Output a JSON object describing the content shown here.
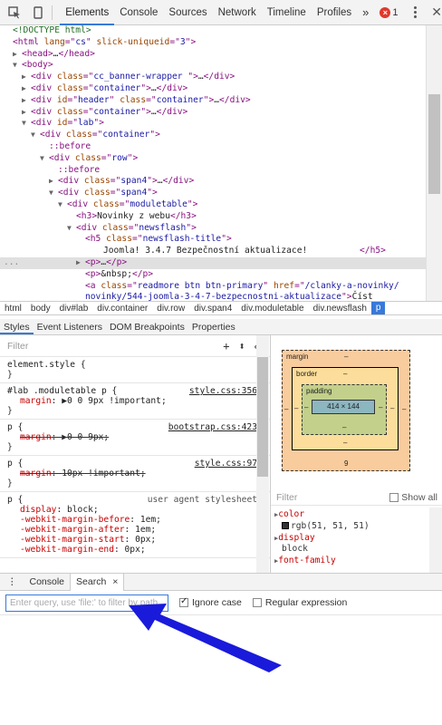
{
  "toolbar": {
    "tabs": [
      "Elements",
      "Console",
      "Sources",
      "Network",
      "Timeline",
      "Profiles"
    ],
    "more": "»",
    "error_count": "1"
  },
  "dom": {
    "lines": [
      {
        "indent": 0,
        "tri": "",
        "parts": [
          [
            "cmt",
            "<!DOCTYPE html>"
          ]
        ]
      },
      {
        "indent": 0,
        "tri": "",
        "parts": [
          [
            "tag",
            "<html "
          ],
          [
            "attr",
            "lang"
          ],
          [
            "tag",
            "=\""
          ],
          [
            "val",
            "cs"
          ],
          [
            "tag",
            "\" "
          ],
          [
            "attr",
            "slick-uniqueid"
          ],
          [
            "tag",
            "=\""
          ],
          [
            "val",
            "3"
          ],
          [
            "tag",
            "\">"
          ]
        ]
      },
      {
        "indent": 1,
        "tri": "▶",
        "parts": [
          [
            "tag",
            "<head>"
          ],
          [
            "txt",
            "…"
          ],
          [
            "tag",
            "</head>"
          ]
        ]
      },
      {
        "indent": 1,
        "tri": "▼",
        "parts": [
          [
            "tag",
            "<body>"
          ]
        ]
      },
      {
        "indent": 2,
        "tri": "▶",
        "parts": [
          [
            "tag",
            "<div "
          ],
          [
            "attr",
            "class"
          ],
          [
            "tag",
            "=\""
          ],
          [
            "val",
            "cc_banner-wrapper "
          ],
          [
            "tag",
            "\">"
          ],
          [
            "txt",
            "…"
          ],
          [
            "tag",
            "</div>"
          ]
        ]
      },
      {
        "indent": 2,
        "tri": "▶",
        "parts": [
          [
            "tag",
            "<div "
          ],
          [
            "attr",
            "class"
          ],
          [
            "tag",
            "=\""
          ],
          [
            "val",
            "container"
          ],
          [
            "tag",
            "\">"
          ],
          [
            "txt",
            "…"
          ],
          [
            "tag",
            "</div>"
          ]
        ]
      },
      {
        "indent": 2,
        "tri": "▶",
        "parts": [
          [
            "tag",
            "<div "
          ],
          [
            "attr",
            "id"
          ],
          [
            "tag",
            "=\""
          ],
          [
            "val",
            "header"
          ],
          [
            "tag",
            "\" "
          ],
          [
            "attr",
            "class"
          ],
          [
            "tag",
            "=\""
          ],
          [
            "val",
            "container"
          ],
          [
            "tag",
            "\">"
          ],
          [
            "txt",
            "…"
          ],
          [
            "tag",
            "</div>"
          ]
        ]
      },
      {
        "indent": 2,
        "tri": "▶",
        "parts": [
          [
            "tag",
            "<div "
          ],
          [
            "attr",
            "class"
          ],
          [
            "tag",
            "=\""
          ],
          [
            "val",
            "container"
          ],
          [
            "tag",
            "\">"
          ],
          [
            "txt",
            "…"
          ],
          [
            "tag",
            "</div>"
          ]
        ]
      },
      {
        "indent": 2,
        "tri": "▼",
        "parts": [
          [
            "tag",
            "<div "
          ],
          [
            "attr",
            "id"
          ],
          [
            "tag",
            "=\""
          ],
          [
            "val",
            "lab"
          ],
          [
            "tag",
            "\">"
          ]
        ]
      },
      {
        "indent": 3,
        "tri": "▼",
        "parts": [
          [
            "tag",
            "<div "
          ],
          [
            "attr",
            "class"
          ],
          [
            "tag",
            "=\""
          ],
          [
            "val",
            "container"
          ],
          [
            "tag",
            "\">"
          ]
        ]
      },
      {
        "indent": 4,
        "tri": "",
        "parts": [
          [
            "pseudo",
            "::before"
          ]
        ]
      },
      {
        "indent": 4,
        "tri": "▼",
        "parts": [
          [
            "tag",
            "<div "
          ],
          [
            "attr",
            "class"
          ],
          [
            "tag",
            "=\""
          ],
          [
            "val",
            "row"
          ],
          [
            "tag",
            "\">"
          ]
        ]
      },
      {
        "indent": 5,
        "tri": "",
        "parts": [
          [
            "pseudo",
            "::before"
          ]
        ]
      },
      {
        "indent": 5,
        "tri": "▶",
        "parts": [
          [
            "tag",
            "<div "
          ],
          [
            "attr",
            "class"
          ],
          [
            "tag",
            "=\""
          ],
          [
            "val",
            "span4"
          ],
          [
            "tag",
            "\">"
          ],
          [
            "txt",
            "…"
          ],
          [
            "tag",
            "</div>"
          ]
        ]
      },
      {
        "indent": 5,
        "tri": "▼",
        "parts": [
          [
            "tag",
            "<div "
          ],
          [
            "attr",
            "class"
          ],
          [
            "tag",
            "=\""
          ],
          [
            "val",
            "span4"
          ],
          [
            "tag",
            "\">"
          ]
        ]
      },
      {
        "indent": 6,
        "tri": "▼",
        "parts": [
          [
            "tag",
            "<div "
          ],
          [
            "attr",
            "class"
          ],
          [
            "tag",
            "=\""
          ],
          [
            "val",
            "moduletable"
          ],
          [
            "tag",
            "\">"
          ]
        ]
      },
      {
        "indent": 7,
        "tri": "",
        "parts": [
          [
            "tag",
            "<h3>"
          ],
          [
            "txt",
            "Novinky z webu"
          ],
          [
            "tag",
            "</h3>"
          ]
        ]
      },
      {
        "indent": 7,
        "tri": "▼",
        "parts": [
          [
            "tag",
            "<div "
          ],
          [
            "attr",
            "class"
          ],
          [
            "tag",
            "=\""
          ],
          [
            "val",
            "newsflash"
          ],
          [
            "tag",
            "\">"
          ]
        ]
      },
      {
        "indent": 8,
        "tri": "",
        "parts": [
          [
            "tag",
            "<h5 "
          ],
          [
            "attr",
            "class"
          ],
          [
            "tag",
            "=\""
          ],
          [
            "val",
            "newsflash-title"
          ],
          [
            "tag",
            "\">"
          ]
        ]
      },
      {
        "indent": 10,
        "tri": "",
        "parts": [
          [
            "txt",
            "Joomla! 3.4.7 Bezpečnostní aktualizace!          "
          ],
          [
            "tag",
            "</h5>"
          ]
        ]
      },
      {
        "indent": 8,
        "tri": "▶",
        "hl": true,
        "parts": [
          [
            "tag",
            "<p>"
          ],
          [
            "txt",
            "…"
          ],
          [
            "tag",
            "</p>"
          ]
        ]
      },
      {
        "indent": 8,
        "tri": "",
        "parts": [
          [
            "tag",
            "<p>"
          ],
          [
            "txt",
            "&nbsp;"
          ],
          [
            "tag",
            "</p>"
          ]
        ]
      },
      {
        "indent": 8,
        "tri": "",
        "parts": [
          [
            "tag",
            "<a "
          ],
          [
            "attr",
            "class"
          ],
          [
            "tag",
            "=\""
          ],
          [
            "val",
            "readmore btn btn-primary"
          ],
          [
            "tag",
            "\" "
          ],
          [
            "attr",
            "href"
          ],
          [
            "tag",
            "=\""
          ],
          [
            "val",
            "/clanky-a-novinky/"
          ]
        ]
      },
      {
        "indent": 8,
        "tri": "",
        "parts": [
          [
            "val",
            "novinky/544-joomla-3-4-7-bezpecnostni-aktualizace"
          ],
          [
            "tag",
            "\">"
          ],
          [
            "txt",
            "Číst"
          ]
        ]
      }
    ]
  },
  "breadcrumbs": [
    "html",
    "body",
    "div#lab",
    "div.container",
    "div.row",
    "div.span4",
    "div.moduletable",
    "div.newsflash",
    "p"
  ],
  "styles_tabs": [
    "Styles",
    "Event Listeners",
    "DOM Breakpoints",
    "Properties"
  ],
  "styles": {
    "filter_placeholder": "Filter",
    "icons": [
      "+",
      "⬍",
      "◈"
    ],
    "rules": [
      {
        "selector": "element.style {",
        "source": "",
        "props": [],
        "close": "}"
      },
      {
        "selector": "#lab .moduletable p {",
        "source": "style.css:356",
        "props": [
          {
            "name": "margin",
            "value": "▶0 0 9px !important;",
            "struck": false
          }
        ],
        "close": "}"
      },
      {
        "selector": "p {",
        "source": "bootstrap.css:423",
        "props": [
          {
            "name": "margin",
            "value": "▶0 0 9px;",
            "struck": true
          }
        ],
        "close": "}"
      },
      {
        "selector": "p {",
        "source": "style.css:97",
        "props": [
          {
            "name": "margin",
            "value": "10px !important;",
            "struck": true
          }
        ],
        "close": "}"
      },
      {
        "selector": "p {",
        "source": "user agent stylesheet",
        "plain": true,
        "props": [
          {
            "name": "display",
            "value": "block;",
            "struck": false
          },
          {
            "name": "-webkit-margin-before",
            "value": "1em;",
            "struck": false
          },
          {
            "name": "-webkit-margin-after",
            "value": "1em;",
            "struck": false
          },
          {
            "name": "-webkit-margin-start",
            "value": "0px;",
            "struck": false
          },
          {
            "name": "-webkit-margin-end",
            "value": "0px;",
            "struck": false
          }
        ],
        "close": ""
      }
    ]
  },
  "boxmodel": {
    "margin_label": "margin",
    "border_label": "border",
    "padding_label": "padding",
    "dash": "–",
    "content": "414 × 144",
    "margin_bottom": "9",
    "filter_placeholder": "Filter",
    "show_all": "Show all",
    "computed": [
      {
        "prop": "color",
        "value": "rgb(51, 51, 51)",
        "swatch": true
      },
      {
        "prop": "display",
        "value": "block"
      },
      {
        "prop": "font-family",
        "value": ""
      }
    ]
  },
  "drawer": {
    "tabs": [
      "Console",
      "Search"
    ],
    "search_placeholder": "Enter query, use 'file:' to filter by path",
    "ignore_case": "Ignore case",
    "regular_expression": "Regular expression"
  },
  "annotation": {
    "arrow_color": "#1a1adb"
  }
}
